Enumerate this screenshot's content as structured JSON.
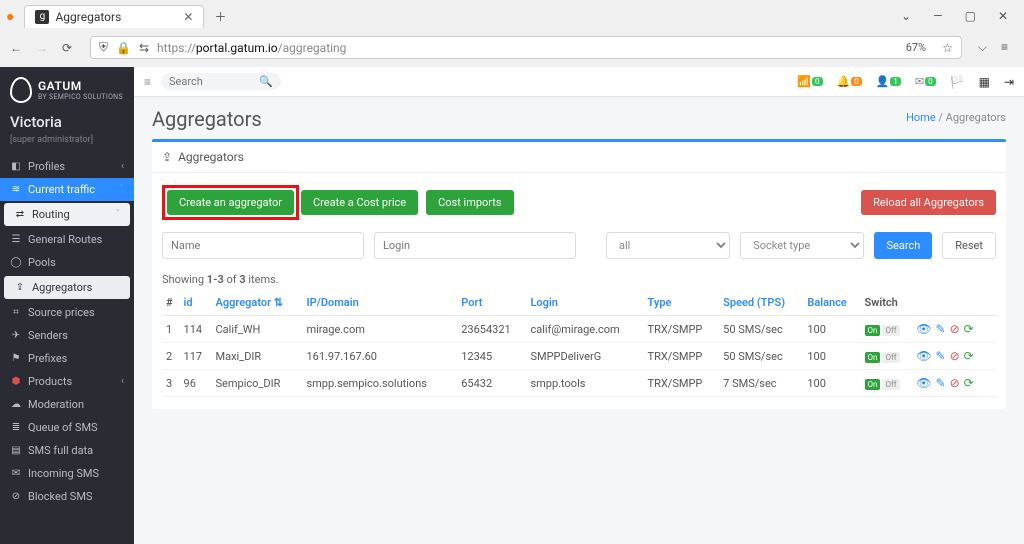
{
  "browser": {
    "tab_title": "Aggregators",
    "url_prefix": "https://",
    "url_host": "portal.gatum.io",
    "url_path": "/aggregating",
    "zoom": "67%"
  },
  "brand": {
    "name": "GATUM",
    "subtitle": "BY SEMPICO SOLUTIONS"
  },
  "user": {
    "name": "Victoria",
    "role": "[super administrator]"
  },
  "sidebar": [
    {
      "label": "Profiles",
      "icon": "◧",
      "caret": "‹"
    },
    {
      "label": "Current traffic",
      "icon": "≋",
      "caret": "ˇ",
      "active": true
    },
    {
      "label": "Routing",
      "icon": "⇄",
      "caret": "ˇ",
      "expando": true
    },
    {
      "label": "General Routes",
      "icon": "☰"
    },
    {
      "label": "Pools",
      "icon": "◯"
    },
    {
      "label": "Aggregators",
      "icon": "⇪",
      "selsub": true
    },
    {
      "label": "Source prices",
      "icon": "⌗"
    },
    {
      "label": "Senders",
      "icon": "✈"
    },
    {
      "label": "Prefixes",
      "icon": "⚑"
    },
    {
      "label": "Products",
      "icon": "⬢",
      "caret": "‹",
      "red": true
    },
    {
      "label": "Moderation",
      "icon": "☁"
    },
    {
      "label": "Queue of SMS",
      "icon": "≣"
    },
    {
      "label": "SMS full data",
      "icon": "▤"
    },
    {
      "label": "Incoming SMS",
      "icon": "✉"
    },
    {
      "label": "Blocked SMS",
      "icon": "⊘"
    }
  ],
  "topbar": {
    "search_placeholder": "Search",
    "badges": [
      "0",
      "0",
      "1",
      "0"
    ]
  },
  "page": {
    "title": "Aggregators",
    "breadcrumb_home": "Home",
    "breadcrumb_sep": " / ",
    "breadcrumb_current": "Aggregators",
    "panel_title": "Aggregators",
    "btn_create": "Create an aggregator",
    "btn_cost": "Create a Cost price",
    "btn_imports": "Cost imports",
    "btn_reload": "Reload all Aggregators",
    "filter_name": "Name",
    "filter_login": "Login",
    "filter_all": "all",
    "filter_socket": "Socket type",
    "btn_search": "Search",
    "btn_reset": "Reset",
    "summary_prefix": "Showing ",
    "summary_range": "1-3",
    "summary_mid": " of ",
    "summary_total": "3",
    "summary_suffix": " items."
  },
  "table": {
    "headers": [
      "#",
      "id",
      "Aggregator",
      "IP/Domain",
      "Port",
      "Login",
      "Type",
      "Speed (TPS)",
      "Balance",
      "Switch",
      ""
    ],
    "sort_col": "Aggregator",
    "rows": [
      {
        "n": "1",
        "id": "114",
        "agg": "Calif_WH",
        "ip": "mirage.com",
        "port": "23654321",
        "login": "calif@mirage.com",
        "type": "TRX/SMPP",
        "speed": "50 SMS/sec",
        "bal": "100",
        "on": "On",
        "off": "Off"
      },
      {
        "n": "2",
        "id": "117",
        "agg": "Maxi_DIR",
        "ip": "161.97.167.60",
        "port": "12345",
        "login": "SMPPDeliverG",
        "type": "TRX/SMPP",
        "speed": "50 SMS/sec",
        "bal": "100",
        "on": "On",
        "off": "Off"
      },
      {
        "n": "3",
        "id": "96",
        "agg": "Sempico_DIR",
        "ip": "smpp.sempico.solutions",
        "port": "65432",
        "login": "smpp.tools",
        "type": "TRX/SMPP",
        "speed": "7 SMS/sec",
        "bal": "100",
        "on": "On",
        "off": "Off"
      }
    ]
  }
}
